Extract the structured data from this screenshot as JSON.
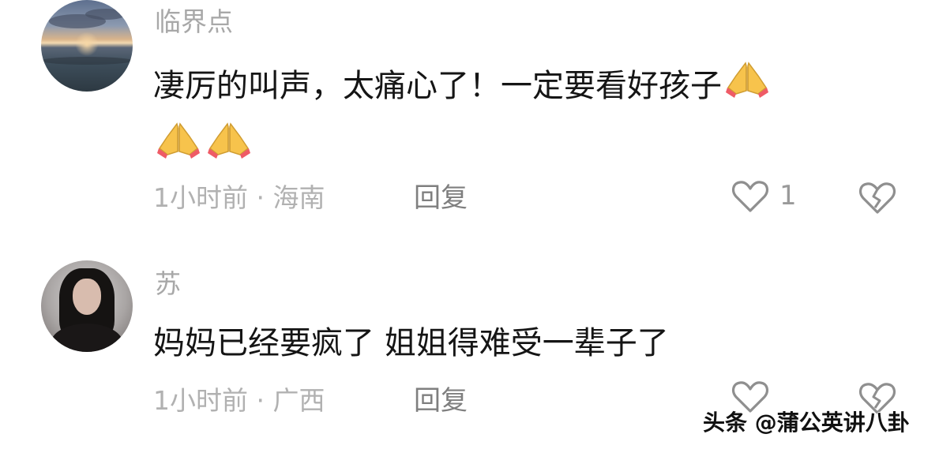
{
  "comments": [
    {
      "username": "临界点",
      "text_line1": "凄厉的叫声，太痛心了！一定要看好孩子",
      "time": "1小时前",
      "location": "海南",
      "reply_label": "回复",
      "like_count": "1"
    },
    {
      "username": "苏",
      "text": "妈妈已经要疯了  姐姐得难受一辈子了",
      "time": "1小时前",
      "location": "广西",
      "reply_label": "回复",
      "like_count": ""
    }
  ],
  "meta_separator": "·",
  "watermark": "头条 @蒲公英讲八卦",
  "icons": {
    "like": "heart-outline-icon",
    "dislike": "broken-heart-icon",
    "emoji": "folded-hands-emoji"
  },
  "colors": {
    "text": "#151515",
    "username": "#a8a8a8",
    "meta": "#b1b1b1",
    "reply": "#7f7f7f",
    "icon": "#9a9a9a",
    "emoji_yellow": "#f7c34c",
    "emoji_cuff": "#ef5b66"
  }
}
